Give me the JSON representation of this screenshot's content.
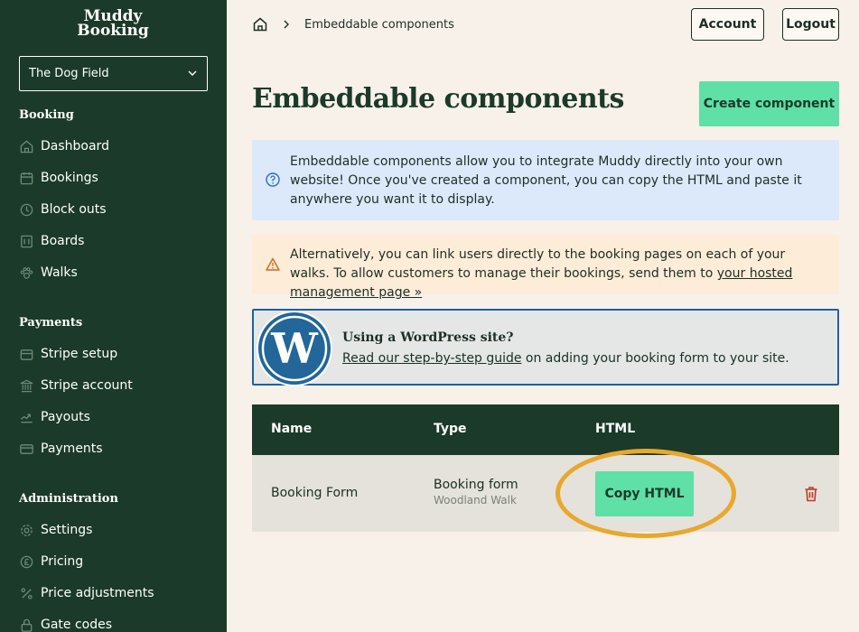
{
  "brand": {
    "line1": "Muddy",
    "line2": "Booking"
  },
  "site_select": {
    "value": "The Dog Field"
  },
  "sidebar": {
    "booking_heading": "Booking",
    "booking_items": [
      {
        "label": "Dashboard",
        "icon": "home-icon"
      },
      {
        "label": "Bookings",
        "icon": "calendar-icon"
      },
      {
        "label": "Block outs",
        "icon": "clock-icon"
      },
      {
        "label": "Boards",
        "icon": "board-icon"
      },
      {
        "label": "Walks",
        "icon": "paw-icon"
      }
    ],
    "payments_heading": "Payments",
    "payments_items": [
      {
        "label": "Stripe setup",
        "icon": "bank-icon"
      },
      {
        "label": "Stripe account",
        "icon": "building-icon"
      },
      {
        "label": "Payouts",
        "icon": "payout-icon"
      },
      {
        "label": "Payments",
        "icon": "card-icon"
      }
    ],
    "admin_heading": "Administration",
    "admin_items": [
      {
        "label": "Settings",
        "icon": "gear-icon"
      },
      {
        "label": "Pricing",
        "icon": "pound-icon"
      },
      {
        "label": "Price adjustments",
        "icon": "percent-icon"
      },
      {
        "label": "Gate codes",
        "icon": "lock-icon"
      }
    ]
  },
  "breadcrumb": {
    "current": "Embeddable components"
  },
  "header": {
    "account_label": "Account",
    "logout_label": "Logout"
  },
  "page": {
    "title": "Embeddable components",
    "create_label": "Create component",
    "info_text": "Embeddable components allow you to integrate Muddy directly into your own website! Once you've created a component, you can copy the HTML and paste it anywhere you want it to display.",
    "warn_text": "Alternatively, you can link users directly to the booking pages on each of your walks. To allow customers to manage their bookings, send them to ",
    "warn_link": "your hosted management page »",
    "wp_title": "Using a WordPress site?",
    "wp_link": "Read our step-by-step guide",
    "wp_text": " on adding your booking form to your site."
  },
  "table": {
    "headers": {
      "name": "Name",
      "type": "Type",
      "html": "HTML"
    },
    "rows": [
      {
        "name": "Booking Form",
        "type": "Booking form",
        "type_sub": "Woodland Walk",
        "action": "Copy HTML"
      }
    ]
  },
  "colors": {
    "sidebar": "#1b3a29",
    "accent": "#5ee0a6",
    "highlight": "#e8a82e",
    "danger": "#c0392b"
  }
}
